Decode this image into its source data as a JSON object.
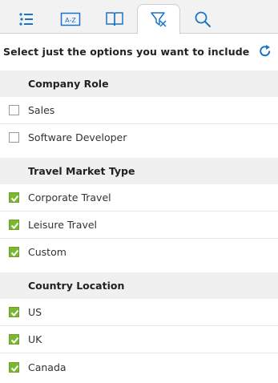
{
  "tabs": [
    {
      "icon": "list-icon",
      "active": false
    },
    {
      "icon": "a-z-sort-icon",
      "label": "A-Z",
      "active": false
    },
    {
      "icon": "book-icon",
      "active": false
    },
    {
      "icon": "filter-icon",
      "active": true
    },
    {
      "icon": "search-icon",
      "active": false
    }
  ],
  "instruction": "Select just the options you want to include",
  "refresh_icon": "refresh-icon",
  "colors": {
    "accent": "#1a73c8",
    "checked": "#7bb832",
    "header_bg": "#f0f0f0"
  },
  "sections": [
    {
      "title": "Company Role",
      "options": [
        {
          "label": "Sales",
          "checked": false
        },
        {
          "label": "Software Developer",
          "checked": false
        }
      ]
    },
    {
      "title": "Travel Market Type",
      "options": [
        {
          "label": "Corporate Travel",
          "checked": true
        },
        {
          "label": "Leisure Travel",
          "checked": true
        },
        {
          "label": "Custom",
          "checked": true
        }
      ]
    },
    {
      "title": "Country Location",
      "options": [
        {
          "label": "US",
          "checked": true
        },
        {
          "label": "UK",
          "checked": true
        },
        {
          "label": "Canada",
          "checked": true
        }
      ]
    }
  ]
}
